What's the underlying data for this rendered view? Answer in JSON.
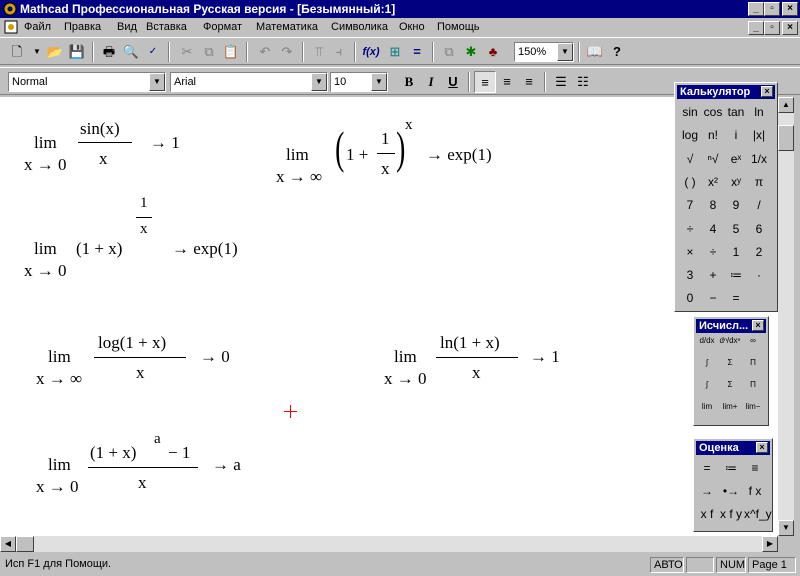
{
  "window": {
    "title": "Mathcad Профессиональная Русская версия - [Безымянный:1]",
    "btn_min": "_",
    "btn_max": "▫",
    "btn_close": "×"
  },
  "menu": [
    "Файл",
    "Правка",
    "Вид",
    "Вставка",
    "Формат",
    "Математика",
    "Символика",
    "Окно",
    "Помощь"
  ],
  "toolbar": {
    "zoom": "150%"
  },
  "format_bar": {
    "style": "Normal",
    "font": "Arial",
    "size": "10",
    "bold": "B",
    "italic": "I",
    "underline": "U"
  },
  "formulas": {
    "lim": "lim",
    "arrow": "→",
    "f1": {
      "sub": "x → 0",
      "num": "sin(x)",
      "den": "x",
      "res": "→ 1"
    },
    "f2": {
      "sub": "x → ∞",
      "open": "(",
      "one": "1 +",
      "num": "1",
      "den": "x",
      "close": ")",
      "exp": "x",
      "res": "→ exp(1)"
    },
    "f3": {
      "sub": "x → 0",
      "base": "(1 + x)",
      "num": "1",
      "den": "x",
      "res": "→ exp(1)"
    },
    "f4": {
      "sub": "x → ∞",
      "num": "log(1 + x)",
      "den": "x",
      "res": "→ 0"
    },
    "f5": {
      "sub": "x → 0",
      "num": "ln(1 + x)",
      "den": "x",
      "res": "→ 1"
    },
    "f6": {
      "sub": "x → 0",
      "num_base": "(1 + x)",
      "num_exp": "a",
      "num_rest": "− 1",
      "den": "x",
      "res": "→ a"
    }
  },
  "palette_calc": {
    "title": "Калькулятор",
    "keys": [
      "sin",
      "cos",
      "tan",
      "ln",
      "log",
      "n!",
      "i",
      "|x|",
      "√",
      "ⁿ√",
      "eˣ",
      "1/x",
      "( )",
      "x²",
      "xʸ",
      "π",
      "7",
      "8",
      "9",
      "/",
      "÷",
      "4",
      "5",
      "6",
      "×",
      "÷",
      "1",
      "2",
      "3",
      "+",
      "≔",
      "·",
      "0",
      "−",
      "="
    ]
  },
  "palette_calculus": {
    "title": "Исчисл...",
    "keys": [
      "d/dx",
      "dⁿ/dxⁿ",
      "∞",
      "∫",
      "Σ",
      "Π",
      "∫",
      "Σ",
      "Π",
      "lim",
      "lim+",
      "lim−"
    ]
  },
  "palette_eval": {
    "title": "Оценка",
    "keys": [
      "=",
      "≔",
      "≡",
      "→",
      "•→",
      "f x",
      "x f",
      "x f y",
      "x^f_y"
    ]
  },
  "status": {
    "help": "Исп F1 для Помощи.",
    "auto": "АВТО",
    "num": "NUM",
    "page": "Page 1"
  },
  "colors": {
    "titlebar": "#000080",
    "face": "#c0c0c0",
    "cursor": "#ff0000"
  }
}
